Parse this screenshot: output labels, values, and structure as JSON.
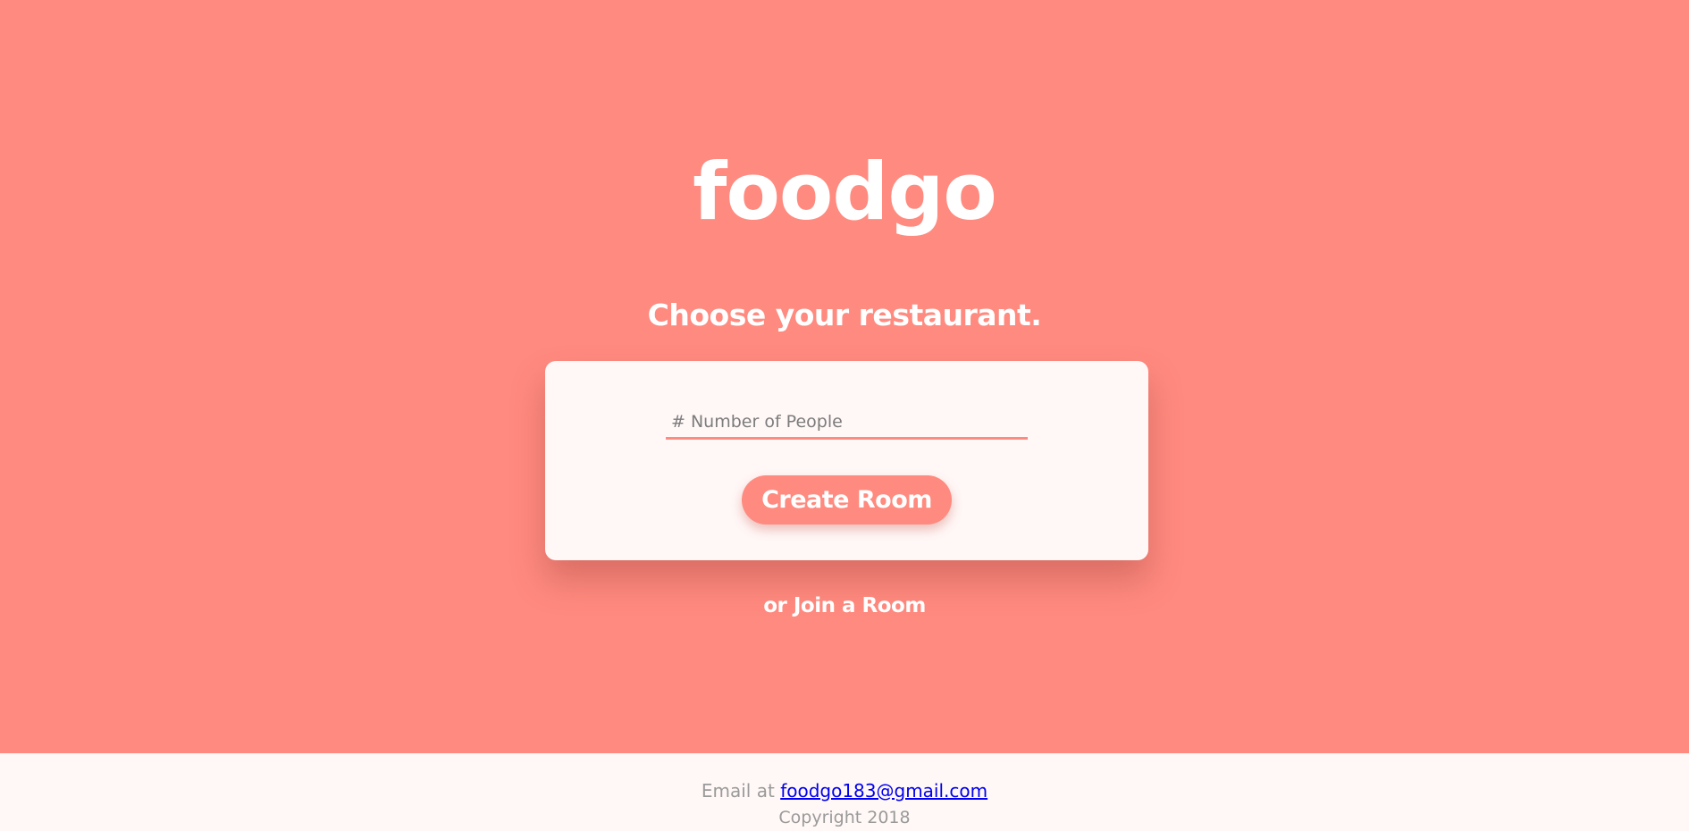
{
  "brand": {
    "logo": "foodgo"
  },
  "hero": {
    "tagline": "Choose your restaurant."
  },
  "form": {
    "people_placeholder": "# Number of People",
    "people_value": "",
    "create_button_label": "Create Room"
  },
  "join": {
    "label": "or Join a Room"
  },
  "footer": {
    "email_prefix": "Email at",
    "email": "foodgo183@gmail.com",
    "copyright": "Copyright 2018"
  },
  "colors": {
    "accent": "#ff8a7f",
    "card_background": "#fff8f7",
    "footer_background": "#fff8f6",
    "footer_text": "#9a9a9a",
    "link": "#0000ee"
  }
}
